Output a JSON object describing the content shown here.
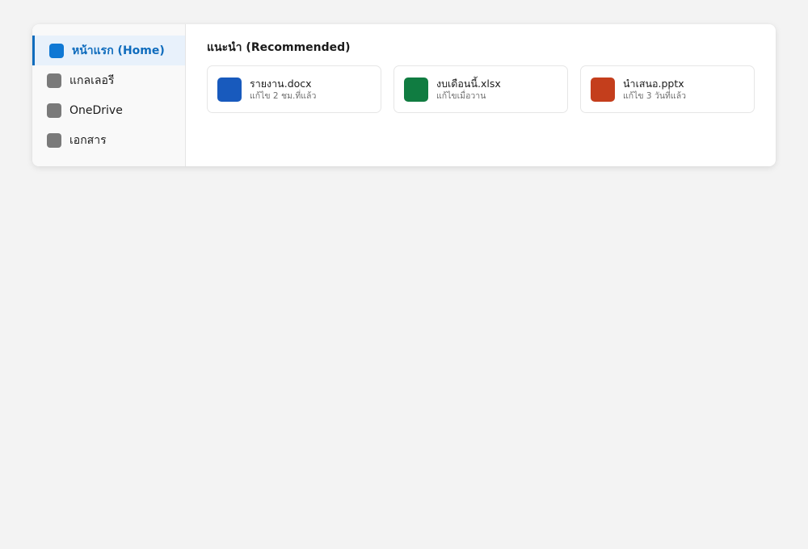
{
  "sidebar": {
    "items": [
      {
        "label": "หน้าแรก (Home)",
        "icon": "home-icon",
        "active": true
      },
      {
        "label": "แกลเลอรี",
        "icon": "gallery-icon",
        "active": false
      },
      {
        "label": "OneDrive",
        "icon": "onedrive-icon",
        "active": false
      },
      {
        "label": "เอกสาร",
        "icon": "documents-icon",
        "active": false
      }
    ]
  },
  "main": {
    "section_title": "แนะนำ (Recommended)",
    "files": [
      {
        "name": "รายงาน.docx",
        "meta": "แก้ไข 2 ชม.ที่แล้ว",
        "icon": "word-file-icon",
        "color": "#185abd"
      },
      {
        "name": "งบเดือนนี้.xlsx",
        "meta": "แก้ไขเมื่อวาน",
        "icon": "excel-file-icon",
        "color": "#107c41"
      },
      {
        "name": "นำเสนอ.pptx",
        "meta": "แก้ไข 3 วันที่แล้ว",
        "icon": "powerpoint-file-icon",
        "color": "#c43e1c"
      }
    ]
  },
  "colors": {
    "accent": "#0f6cbd",
    "background": "#f3f3f3"
  }
}
